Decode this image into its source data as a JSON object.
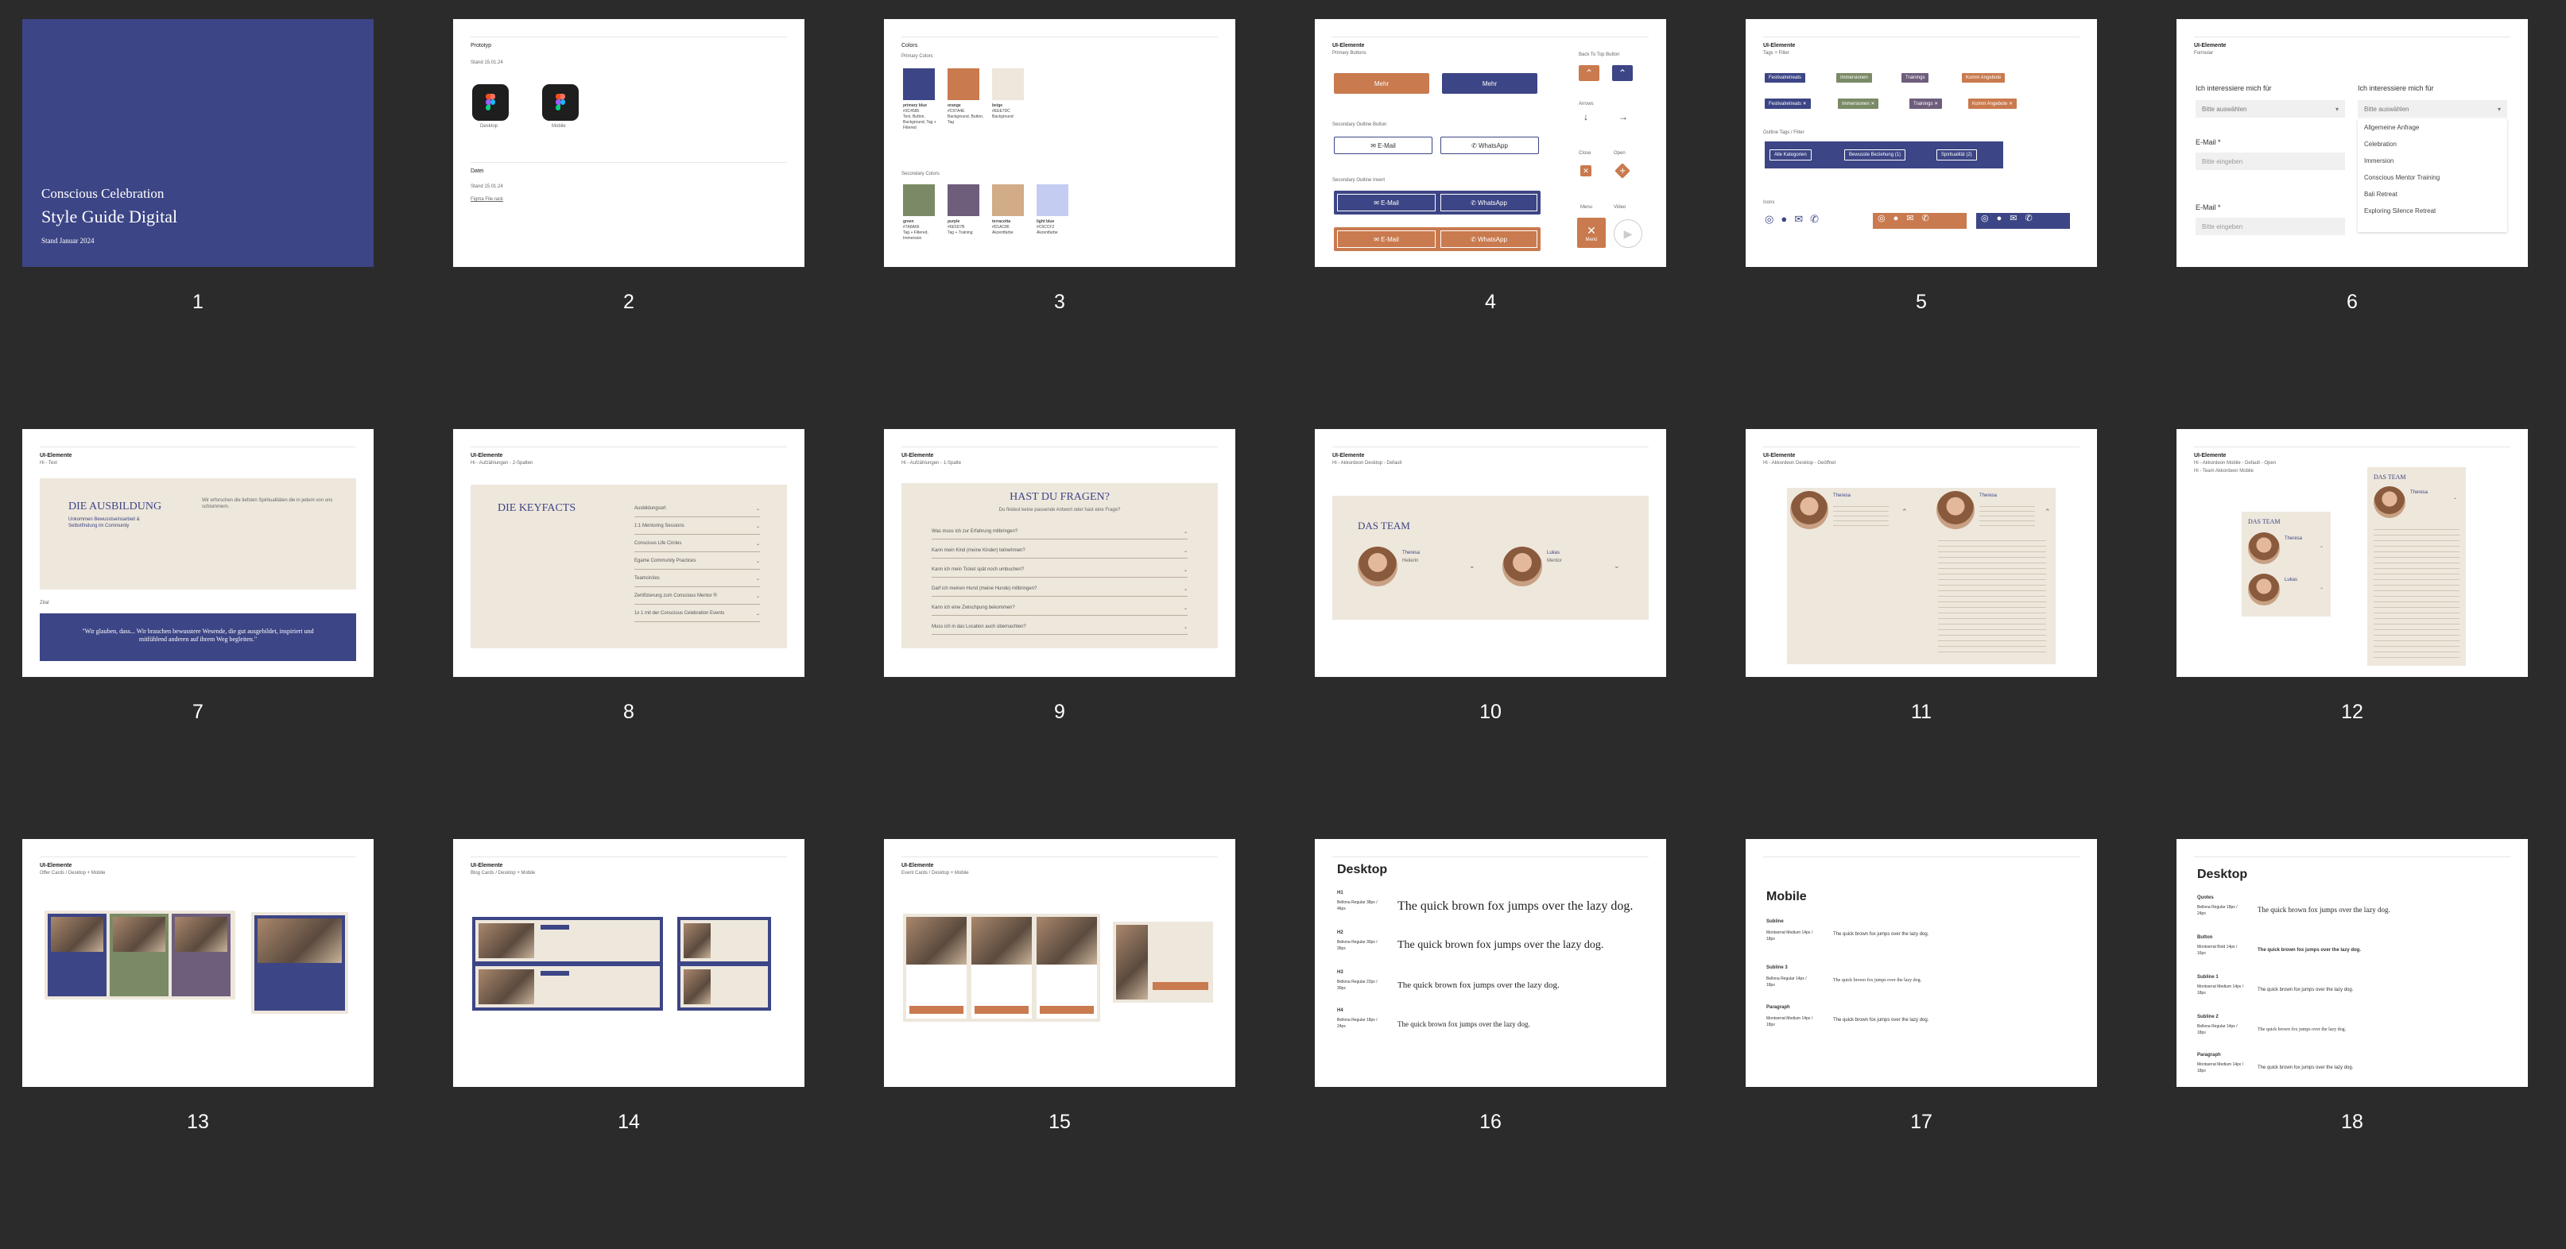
{
  "colors": {
    "navy": "#3c4585",
    "orange": "#c97a4e",
    "beige": "#eee7dc",
    "green": "#7a8a66",
    "purple": "#6e5d7b",
    "terracotta": "#d1ac86",
    "lightblue": "#c5ccf2",
    "background": "#2b2b2b"
  },
  "slide_numbers": [
    "1",
    "2",
    "3",
    "4",
    "5",
    "6",
    "7",
    "8",
    "9",
    "10",
    "11",
    "12",
    "13",
    "14",
    "15",
    "16",
    "17",
    "18"
  ],
  "s1": {
    "line1": "Conscious Celebration",
    "line2": "Style Guide Digital",
    "line3": "Stand Januar 2024"
  },
  "s2": {
    "title": "Prototyp",
    "date": "Stand 15.01.24",
    "app1": "Desktop",
    "app2": "Mobile",
    "title2": "Datei",
    "date2": "Stand 15.01.24",
    "link": "Figma File.rack"
  },
  "s3": {
    "title": "Colors",
    "primary": "Primary Colors",
    "secondary": "Secondary Colors",
    "swatches": [
      {
        "name": "primary blue",
        "hex": "#3C4585",
        "use": "Text, Button, Background, Tag + Filtered"
      },
      {
        "name": "orange",
        "hex": "#C97A4E",
        "use": "Background, Button, Tag"
      },
      {
        "name": "beige",
        "hex": "#EEE7DC",
        "use": "Background"
      },
      {
        "name": "green",
        "hex": "#7A8A66",
        "use": "Tag + Filtered, Immersion"
      },
      {
        "name": "purple",
        "hex": "#6E5D7B",
        "use": "Tag + Training"
      },
      {
        "name": "terracotta",
        "hex": "#D1AC86",
        "use": "Akzentfarbe"
      },
      {
        "name": "light blue",
        "hex": "#C5CCF2",
        "use": "Akzentfarbe"
      }
    ]
  },
  "s4": {
    "title": "UI-Elemente",
    "sub": "Primary Buttons",
    "more": "Mehr",
    "sec": "Secondary Outline Button",
    "email": "✉ E-Mail",
    "whatsapp": "✆ WhatsApp",
    "sec2": "Secondary Outline Invert",
    "back": "Back To Top Button",
    "arrows": "Arrows",
    "close": "Close",
    "open": "Open",
    "menu": "Menu",
    "menu_label": "Menü",
    "video": "Video"
  },
  "s5": {
    "title": "UI-Elemente",
    "sub": "Tags + Filter",
    "tags": [
      "Festivalretreats",
      "Immersionen",
      "Trainings",
      "Komm Angebote"
    ],
    "filter_title": "Outline Tags / Filter",
    "filters": [
      "Alle Kategorien",
      "Bewusste Beziehung (1)",
      "Spiritualität (2)"
    ],
    "icons_title": "Icons"
  },
  "s6": {
    "title": "UI-Elemente",
    "sub": "Formular",
    "label": "Ich interessiere mich für",
    "select": "Bitte auswählen",
    "email_label": "E-Mail *",
    "email_ph": "Bitte eingeben",
    "options": [
      "Allgemeine Anfrage",
      "Celebration",
      "Immersion",
      "Conscious Mentor Training",
      "Bali Retreat",
      "Exploring Silence Retreat"
    ]
  },
  "s7": {
    "title": "UI-Elemente",
    "sub": "Hi - Text",
    "heading": "DIE AUSBILDUNG",
    "subheading": "Unkommen Bewusstseinsarbeit & Selbstfindung im Community",
    "body": "Wir erforschen die tiefsten Spiritualitäten die in jedem von uns schlummern.",
    "quote_label": "Zitat",
    "quote": "\"Wir glauben, dass... Wir brauchen bewusstere Wesende, die gut ausgebildet, inspiriert und mitfühlend anderen auf ihrem Weg begleiten.\""
  },
  "s8": {
    "title": "UI-Elemente",
    "sub": "Hi - Aufzählungen - 2-Spalten",
    "heading": "DIE KEYFACTS",
    "rows": [
      "Ausbildungsort",
      "2 Monate Zeit in Wiltzen",
      "1:1 Mentoring Sessions",
      "Conscious Life Circles",
      "Egame Community Practices",
      "Teamcircles",
      "Zertifizierung zum Conscious Mentor ®",
      "1x 1 mit der Conscious Celebration Events"
    ]
  },
  "s9": {
    "title": "UI-Elemente",
    "sub": "Hi - Aufzählungen - 1-Spalte",
    "heading": "HAST DU FRAGEN?",
    "intro": "Du findest keine passende Antwort oder hast eine Frage?",
    "rows": [
      "Was muss ich zur Erfahrung mitbringen?",
      "Kann mein Kind (meine Kinder) teilnehmen?",
      "Kann ich mein Ticket spät noch umbuchen?",
      "Darf ich meinen Hund (meine Hunde) mitbringen?",
      "Kann ich eine Zwischpung bekommen?",
      "Muss ich in das Location auch übernachten?"
    ]
  },
  "s10": {
    "title": "UI-Elemente",
    "sub": "Hi - Akkordeon Desktop - Default",
    "heading": "DAS TEAM",
    "p1_name": "Theresa",
    "p1_role": "Heilerin",
    "p2_name": "Lukas",
    "p2_role": "Mentor"
  },
  "s11": {
    "title": "UI-Elemente",
    "sub": "Hi - Akkordeon Desktop - Geöffnet",
    "p1_name": "Theresa",
    "p2_name": "Theresa"
  },
  "s12": {
    "title": "UI-Elemente",
    "sub": "Hi - Akkordeon Mobile - Default - Open",
    "sub2": "Hi - Team Akkordeon Mobile",
    "heading": "DAS TEAM",
    "heading2": "DAS TEAM",
    "p1_name": "Theresa",
    "p2_name": "Lukas",
    "p3_name": "Theresa"
  },
  "s13": {
    "title": "UI-Elemente",
    "sub": "Offer Cards / Desktop + Mobile"
  },
  "s14": {
    "title": "UI-Elemente",
    "sub": "Blog Cards / Desktop + Mobile"
  },
  "s15": {
    "title": "UI-Elemente",
    "sub": "Event Cards / Desktop + Mobile"
  },
  "s16": {
    "title": "Desktop",
    "rows": [
      {
        "label": "H1",
        "meta": "Bellona Regular 38px / 46px",
        "sample": "The quick brown fox jumps over the lazy dog."
      },
      {
        "label": "H2",
        "meta": "Bellona Regular 30px / 36px",
        "sample": "The quick brown fox jumps over the lazy dog."
      },
      {
        "label": "H3",
        "meta": "Bellona Regular 22px / 30px",
        "sample": "The quick brown fox jumps over the lazy dog."
      },
      {
        "label": "H4",
        "meta": "Bellona Regular 18px / 24px",
        "sample": "The quick brown fox jumps over the lazy dog."
      }
    ]
  },
  "s17": {
    "title": "Mobile",
    "rows": [
      {
        "label": "Subline",
        "meta": "Montserrat Medium 14px / 18px",
        "sample": "The quick brown fox jumps over the lazy dog."
      },
      {
        "label": "Subline 3",
        "meta": "Bellona Regular 14px / 18px",
        "sample": "The quick brown fox jumps over the lazy dog."
      },
      {
        "label": "Paragraph",
        "meta": "Montserrat Medium 14px / 18px",
        "sample": "The quick brown fox jumps over the lazy dog."
      }
    ]
  },
  "s18": {
    "title": "Desktop",
    "rows": [
      {
        "label": "Quotes",
        "meta": "Bellona Regular 18px / 24px",
        "sample": "The quick brown fox jumps over the lazy dog."
      },
      {
        "label": "Button",
        "meta": "Montserrat Bold 14px / 16px",
        "sample": "The quick brown fox jumps over the lazy dog."
      },
      {
        "label": "Subline 1",
        "meta": "Montserrat Medium 14px / 18px",
        "sample": "The quick brown fox jumps over the lazy dog."
      },
      {
        "label": "Subline 2",
        "meta": "Bellona Regular 14px / 18px",
        "sample": "The quick brown fox jumps over the lazy dog."
      },
      {
        "label": "Paragraph",
        "meta": "Montserrat Medium 14px / 18px",
        "sample": "The quick brown fox jumps over the lazy dog."
      }
    ]
  }
}
